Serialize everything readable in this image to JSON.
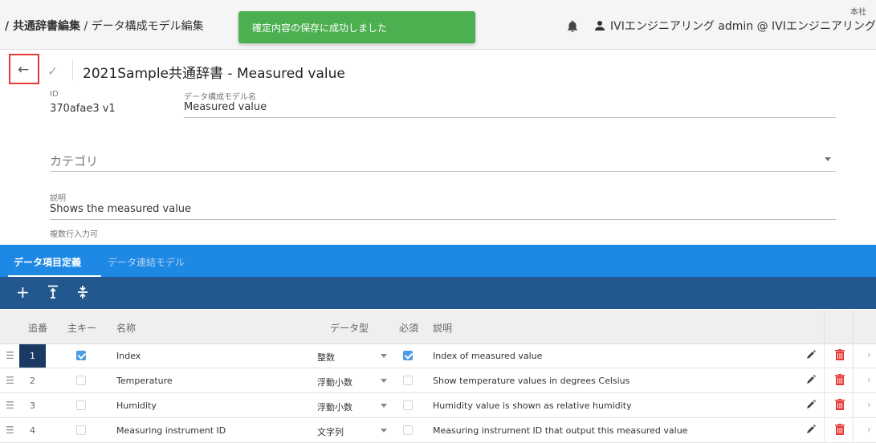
{
  "topbar": {
    "breadcrumb_parent": "/ 共通辞書編集",
    "breadcrumb_current": " / データ構成モデル編集",
    "toast": "確定内容の保存に成功しました",
    "user": "IVIエンジニアリング admin @ IVIエンジニアリング",
    "org": "本社"
  },
  "header": {
    "title": "2021Sample共通辞書 - Measured value"
  },
  "form": {
    "id_label": "ID",
    "id_value": "370afae3 v1",
    "name_label": "データ構成モデル名",
    "name_value": "Measured value",
    "category_label": "カテゴリ",
    "desc_label": "説明",
    "desc_value": "Shows the measured value",
    "desc_hint": "複数行入力可"
  },
  "tabs": [
    {
      "label": "データ項目定義"
    },
    {
      "label": "データ連結モデル"
    }
  ],
  "table": {
    "headers": {
      "seq": "追番",
      "key": "主キー",
      "name": "名称",
      "type": "データ型",
      "required": "必須",
      "desc": "説明"
    },
    "rows": [
      {
        "seq": "1",
        "name": "Index",
        "type": "整数",
        "desc": "Index of measured value"
      },
      {
        "seq": "2",
        "name": "Temperature",
        "type": "浮動小数",
        "desc": "Show temperature values in degrees Celsius"
      },
      {
        "seq": "3",
        "name": "Humidity",
        "type": "浮動小数",
        "desc": "Humidity value is shown as relative humidity"
      },
      {
        "seq": "4",
        "name": "Measuring instrument ID",
        "type": "文字列",
        "desc": "Measuring instrument ID that output this measured value"
      }
    ]
  },
  "icons": {
    "add": "add-icon",
    "insert_above": "insert-above-icon",
    "insert_below": "insert-below-icon"
  },
  "colors": {
    "toast": "#4caf50",
    "tabs": "#1e88e5",
    "toolbar": "#23588e",
    "selected_seq": "#1a3a63",
    "delete": "#e53935"
  }
}
